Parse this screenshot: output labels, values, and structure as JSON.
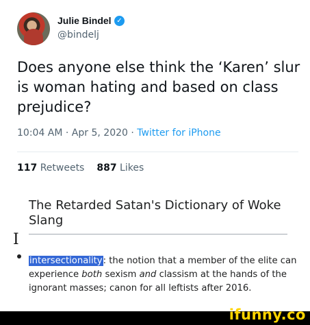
{
  "tweet": {
    "author_name": "Julie Bindel",
    "verified_glyph": "✓",
    "handle": "@bindelj",
    "text": "Does anyone else think the ‘Karen’ slur is woman hating and based on class prejudice?",
    "timestamp": "10:04 AM · Apr 5, 2020 · ",
    "source": "Twitter for iPhone",
    "retweets_count": "117",
    "retweets_label": "Retweets",
    "likes_count": "887",
    "likes_label": "Likes"
  },
  "embed": {
    "title": "The Retarded Satan's Dictionary of Woke Slang",
    "cursor_glyph": "I",
    "term": "intersectionality",
    "definition_a": ": the notion that a member of the elite can experience ",
    "definition_em1": "both",
    "definition_b": " sexism ",
    "definition_em2": "and",
    "definition_c": " classism at the hands of the ignorant masses; canon for all leftists after 2016."
  },
  "watermark": {
    "text": "ifunny.co"
  },
  "colors": {
    "link": "#1d9bf0",
    "verified": "#1d9bf0",
    "highlight": "#3367d6",
    "brand": "#ffd400"
  },
  "icons": {
    "verified": "verified-badge-icon",
    "avatar": "profile-photo"
  }
}
